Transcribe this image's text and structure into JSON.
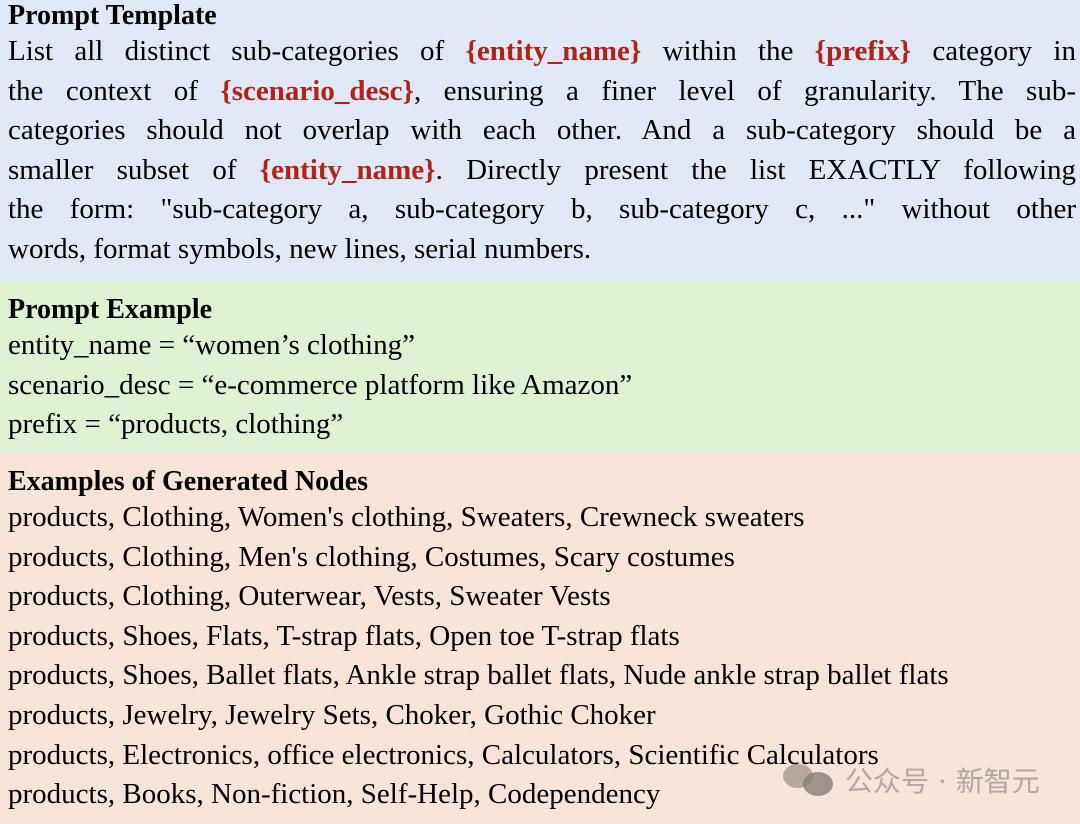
{
  "template": {
    "heading": "Prompt Template",
    "lines": [
      [
        {
          "t": "List all distinct sub-categories of ",
          "var": false
        },
        {
          "t": "{entity_name}",
          "var": true
        },
        {
          "t": " within the ",
          "var": false
        },
        {
          "t": "{prefix}",
          "var": true
        },
        {
          "t": " category in",
          "var": false
        }
      ],
      [
        {
          "t": "the context of ",
          "var": false
        },
        {
          "t": "{scenario_desc}",
          "var": true
        },
        {
          "t": ", ensuring a finer level of granularity. The sub-",
          "var": false
        }
      ],
      [
        {
          "t": "categories should not overlap with each other. And a sub-category should be a",
          "var": false
        }
      ],
      [
        {
          "t": "smaller subset of ",
          "var": false
        },
        {
          "t": "{entity_name}",
          "var": true
        },
        {
          "t": ". Directly present the list EXACTLY following",
          "var": false
        }
      ],
      [
        {
          "t": "the form: \"sub-category a, sub-category b, sub-category c, ...\" without other",
          "var": false
        }
      ],
      [
        {
          "t": "words, format symbols, new lines, serial numbers.",
          "var": false
        }
      ]
    ]
  },
  "example": {
    "heading": "Prompt Example",
    "lines": [
      "entity_name = “women’s clothing”",
      "scenario_desc = “e-commerce platform like Amazon”",
      "prefix = “products, clothing”"
    ]
  },
  "nodes": {
    "heading": "Examples of Generated Nodes",
    "lines": [
      "products, Clothing, Women's clothing, Sweaters, Crewneck sweaters",
      "products, Clothing, Men's clothing, Costumes, Scary costumes",
      "products, Clothing, Outerwear, Vests, Sweater Vests",
      "products, Shoes, Flats, T-strap flats, Open toe T-strap flats",
      "products, Shoes, Ballet flats, Ankle strap ballet flats, Nude ankle strap ballet flats",
      "products, Jewelry, Jewelry Sets, Choker, Gothic Choker",
      "products, Electronics, office electronics, Calculators, Scientific Calculators",
      "products, Books, Non-fiction, Self-Help, Codependency"
    ]
  },
  "watermark": {
    "icon": "wechat-icon",
    "text": "公众号 · 新智元"
  },
  "colors": {
    "variable": "#b02318",
    "template_bg": "#dfe8f4",
    "example_bg": "#dff0d3",
    "nodes_bg": "#f6e3d9"
  }
}
